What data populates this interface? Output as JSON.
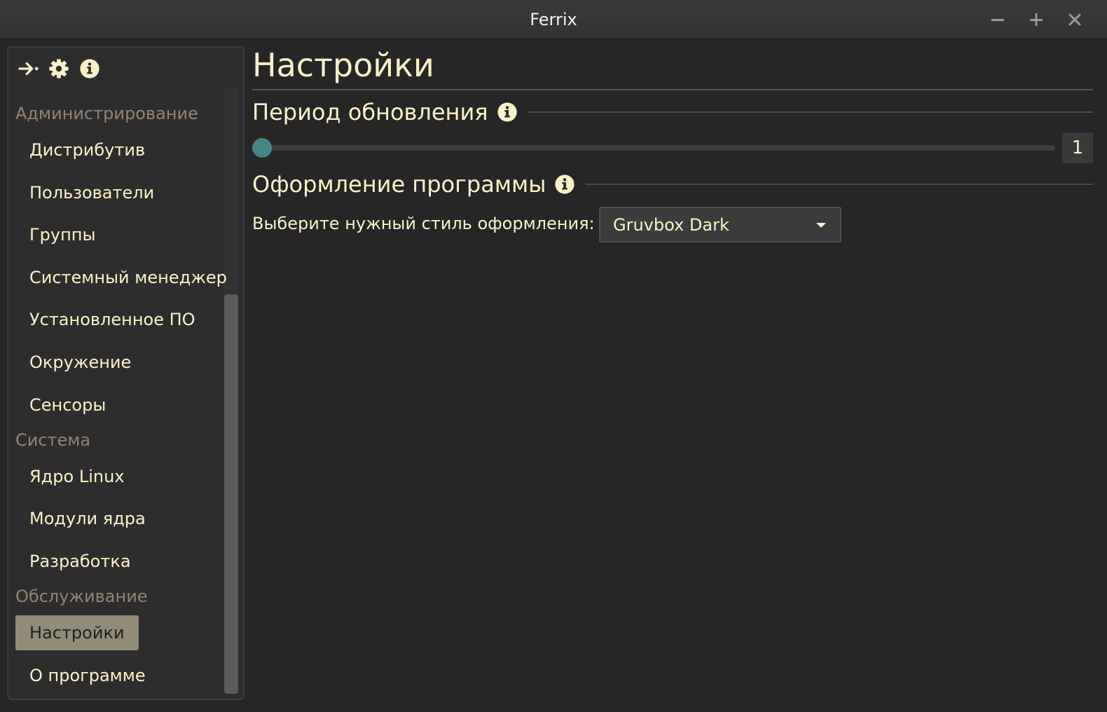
{
  "window": {
    "title": "Ferrix",
    "controls": [
      "minimize-icon",
      "maximize-icon",
      "close-icon"
    ]
  },
  "toolbar": {
    "icons": [
      "export-icon",
      "gear-icon",
      "info-icon"
    ]
  },
  "sidebar": {
    "groups": [
      {
        "label": "Администрирование",
        "items": [
          {
            "label": "Дистрибутив"
          },
          {
            "label": "Пользователи"
          },
          {
            "label": "Группы"
          },
          {
            "label": "Системный менеджер"
          },
          {
            "label": "Установленное ПО"
          },
          {
            "label": "Окружение"
          },
          {
            "label": "Сенсоры"
          }
        ]
      },
      {
        "label": "Система",
        "items": [
          {
            "label": "Ядро Linux"
          },
          {
            "label": "Модули ядра"
          },
          {
            "label": "Разработка"
          }
        ]
      },
      {
        "label": "Обслуживание",
        "items": [
          {
            "label": "Настройки",
            "active": true
          },
          {
            "label": "О программе"
          }
        ]
      }
    ]
  },
  "main": {
    "title": "Настройки",
    "update_period": {
      "heading": "Период обновления",
      "value": "1",
      "slider_fraction": 0.0
    },
    "appearance": {
      "heading": "Оформление программы",
      "label": "Выберите нужный стиль оформления:",
      "selected_style": "Gruvbox Dark"
    }
  },
  "colors": {
    "background": "#262626",
    "text": "#fbf1c7",
    "muted": "#928374",
    "accent": "#458588",
    "active_item": "#928b76"
  }
}
